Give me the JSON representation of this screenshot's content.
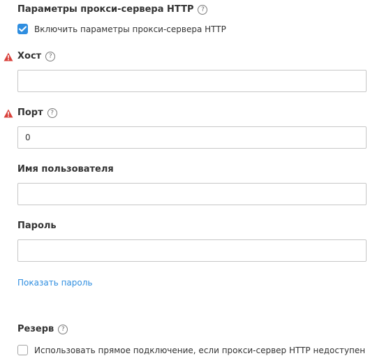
{
  "http_proxy": {
    "title": "Параметры прокси-сервера HTTP",
    "enable_checkbox": {
      "label": "Включить параметры прокси-сервера HTTP",
      "checked": true
    }
  },
  "host": {
    "label": "Хост",
    "value": "",
    "has_warning": true
  },
  "port": {
    "label": "Порт",
    "value": "0",
    "has_warning": true
  },
  "username": {
    "label": "Имя пользователя",
    "value": ""
  },
  "password": {
    "label": "Пароль",
    "value": ""
  },
  "show_password_link": "Показать пароль",
  "fallback": {
    "title": "Резерв",
    "direct_checkbox": {
      "label": "Использовать прямое подключение, если прокси-сервер HTTP недоступен",
      "checked": false
    }
  },
  "icons": {
    "help": "question-circle-icon",
    "warning": "warning-triangle-icon",
    "check": "checkmark-icon"
  },
  "colors": {
    "accent": "#2f8ee0",
    "warning": "#d9413b",
    "text": "#333333",
    "border": "#c7c7c7"
  }
}
